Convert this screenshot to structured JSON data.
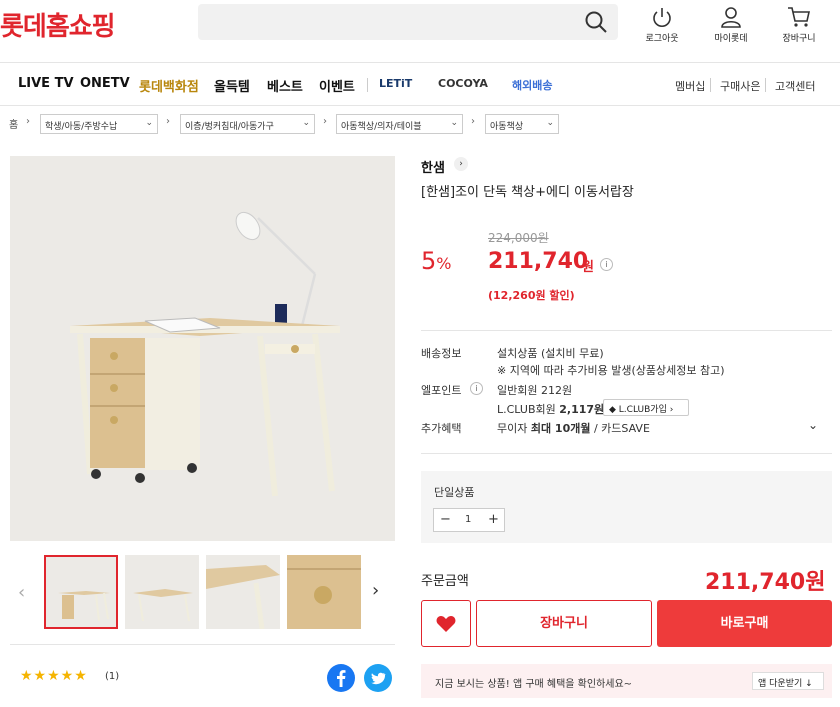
{
  "header": {
    "logo": "롯데홈쇼핑",
    "logout_label": "로그아웃",
    "mypage_label": "마이롯데",
    "cart_label": "장바구니"
  },
  "nav": {
    "items": [
      "LIVE TV",
      "ONETV",
      "롯데백화점",
      "올득템",
      "베스트",
      "이벤트"
    ],
    "brands": [
      "LETiT",
      "COCOYA",
      "해외배송"
    ],
    "right": [
      "멤버십",
      "구매사은",
      "고객센터"
    ]
  },
  "breadcrumb": {
    "home": "홈",
    "levels": [
      "학생/아동/주방수납",
      "이층/벙커침대/아동가구",
      "아동책상/의자/테이블",
      "아동책상"
    ]
  },
  "product": {
    "brand": "한샘",
    "name": "[한샘]조이 단독 책상+에디 이동서랍장",
    "discount_rate": "5",
    "discount_unit": "%",
    "original_price": "224,000원",
    "price": "211,740",
    "price_unit": "원",
    "sale_amount": "(12,260원 할인)"
  },
  "info": {
    "shipping_label": "배송정보",
    "shipping_line1": "설치상품 (설치비 무료)",
    "shipping_line2": "※ 지역에 따라 추가비용 발생(상품상세정보 참고)",
    "point_label": "엘포인트",
    "point_general": "일반회원 212원",
    "point_lclub_prefix": "L.CLUB회원 ",
    "point_lclub_value": "2,117원",
    "lclub_button": "L.CLUB가입",
    "benefit_label": "추가혜택",
    "benefit_prefix": "무이자 ",
    "benefit_bold": "최대 10개월",
    "benefit_suffix": " / 카드SAVE"
  },
  "option": {
    "label": "단일상품",
    "quantity": "1"
  },
  "order": {
    "total_label": "주문금액",
    "total_price": "211,740원",
    "cart_button": "장바구니",
    "buy_button": "바로구매"
  },
  "app_banner": {
    "text": "지금 보시는 상품! 앱 구매 혜택을 확인하세요~",
    "button": "앱 다운받기"
  },
  "reviews": {
    "stars": "★★★★★",
    "count": "(1)"
  },
  "colors": {
    "accent": "#e0252d",
    "buy": "#ee3b3b",
    "facebook": "#1877f2",
    "twitter": "#1da1f2"
  }
}
